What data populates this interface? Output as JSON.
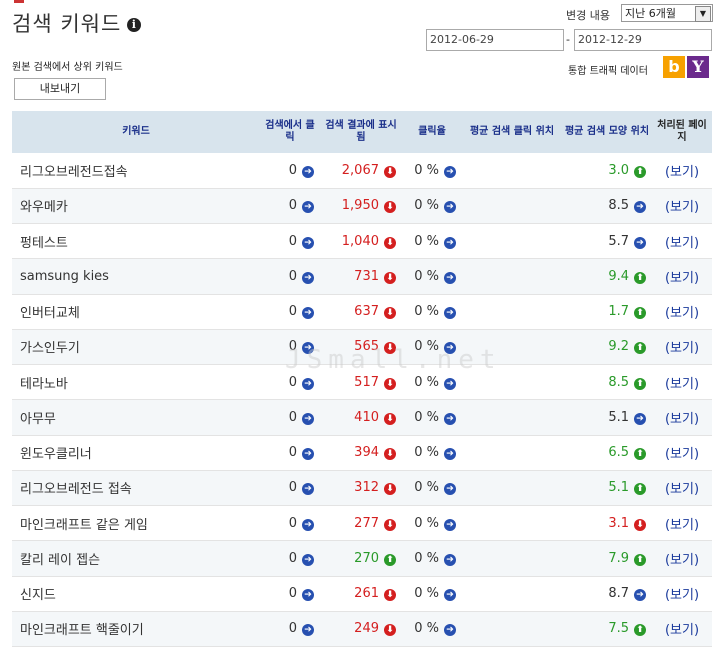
{
  "header": {
    "title": "검색 키워드",
    "info_icon": "info-icon",
    "range_label": "변경 내용",
    "range_value": "지난 6개월",
    "date_from": "2012-06-29",
    "date_sep": "-",
    "date_to": "2012-12-29",
    "subtitle": "원본 검색에서 상위 키워드",
    "traffic_label": "통합 트래픽 데이터",
    "bing_glyph": "b",
    "yahoo_glyph": "Y",
    "export_label": "내보내기"
  },
  "watermark": "JSmall.net",
  "table": {
    "columns": [
      "키워드",
      "검색에서 클릭",
      "검색 결과에 표시됨",
      "클릭율",
      "평균 검색 클릭 위치",
      "평균 검색 모양 위치",
      "처리된 페이지"
    ],
    "rows": [
      {
        "keyword": "리그오브레전드접속",
        "clicks": "0",
        "clicks_trend": "right",
        "impressions": "2,067",
        "imp_trend": "down",
        "ctr": "0 %",
        "ctr_trend": "right",
        "avg_click": "",
        "avg_pos": "3.0",
        "pos_trend": "up",
        "view": "(보기)"
      },
      {
        "keyword": "와우메카",
        "clicks": "0",
        "clicks_trend": "right",
        "impressions": "1,950",
        "imp_trend": "down",
        "ctr": "0 %",
        "ctr_trend": "right",
        "avg_click": "",
        "avg_pos": "8.5",
        "pos_trend": "right",
        "view": "(보기)"
      },
      {
        "keyword": "펑테스트",
        "clicks": "0",
        "clicks_trend": "right",
        "impressions": "1,040",
        "imp_trend": "down",
        "ctr": "0 %",
        "ctr_trend": "right",
        "avg_click": "",
        "avg_pos": "5.7",
        "pos_trend": "right",
        "view": "(보기)"
      },
      {
        "keyword": "samsung kies",
        "clicks": "0",
        "clicks_trend": "right",
        "impressions": "731",
        "imp_trend": "down",
        "ctr": "0 %",
        "ctr_trend": "right",
        "avg_click": "",
        "avg_pos": "9.4",
        "pos_trend": "up",
        "view": "(보기)"
      },
      {
        "keyword": "인버터교체",
        "clicks": "0",
        "clicks_trend": "right",
        "impressions": "637",
        "imp_trend": "down",
        "ctr": "0 %",
        "ctr_trend": "right",
        "avg_click": "",
        "avg_pos": "1.7",
        "pos_trend": "up",
        "view": "(보기)"
      },
      {
        "keyword": "가스인두기",
        "clicks": "0",
        "clicks_trend": "right",
        "impressions": "565",
        "imp_trend": "down",
        "ctr": "0 %",
        "ctr_trend": "right",
        "avg_click": "",
        "avg_pos": "9.2",
        "pos_trend": "up",
        "view": "(보기)"
      },
      {
        "keyword": "테라노바",
        "clicks": "0",
        "clicks_trend": "right",
        "impressions": "517",
        "imp_trend": "down",
        "ctr": "0 %",
        "ctr_trend": "right",
        "avg_click": "",
        "avg_pos": "8.5",
        "pos_trend": "up",
        "view": "(보기)"
      },
      {
        "keyword": "아무무",
        "clicks": "0",
        "clicks_trend": "right",
        "impressions": "410",
        "imp_trend": "down",
        "ctr": "0 %",
        "ctr_trend": "right",
        "avg_click": "",
        "avg_pos": "5.1",
        "pos_trend": "right",
        "view": "(보기)"
      },
      {
        "keyword": "윈도우클리너",
        "clicks": "0",
        "clicks_trend": "right",
        "impressions": "394",
        "imp_trend": "down",
        "ctr": "0 %",
        "ctr_trend": "right",
        "avg_click": "",
        "avg_pos": "6.5",
        "pos_trend": "up",
        "view": "(보기)"
      },
      {
        "keyword": "리그오브레전드 접속",
        "clicks": "0",
        "clicks_trend": "right",
        "impressions": "312",
        "imp_trend": "down",
        "ctr": "0 %",
        "ctr_trend": "right",
        "avg_click": "",
        "avg_pos": "5.1",
        "pos_trend": "up",
        "view": "(보기)"
      },
      {
        "keyword": "마인크래프트 같은 게임",
        "clicks": "0",
        "clicks_trend": "right",
        "impressions": "277",
        "imp_trend": "down",
        "ctr": "0 %",
        "ctr_trend": "right",
        "avg_click": "",
        "avg_pos": "3.1",
        "pos_trend": "down",
        "view": "(보기)"
      },
      {
        "keyword": "칼리 레이 젭슨",
        "clicks": "0",
        "clicks_trend": "right",
        "impressions": "270",
        "imp_trend": "up",
        "ctr": "0 %",
        "ctr_trend": "right",
        "avg_click": "",
        "avg_pos": "7.9",
        "pos_trend": "up",
        "view": "(보기)"
      },
      {
        "keyword": "신지드",
        "clicks": "0",
        "clicks_trend": "right",
        "impressions": "261",
        "imp_trend": "down",
        "ctr": "0 %",
        "ctr_trend": "right",
        "avg_click": "",
        "avg_pos": "8.7",
        "pos_trend": "right",
        "view": "(보기)"
      },
      {
        "keyword": "마인크래프트 핵줄이기",
        "clicks": "0",
        "clicks_trend": "right",
        "impressions": "249",
        "imp_trend": "down",
        "ctr": "0 %",
        "ctr_trend": "right",
        "avg_click": "",
        "avg_pos": "7.5",
        "pos_trend": "up",
        "view": "(보기)"
      }
    ]
  },
  "colors": {
    "header_bg": "#d8e4ed",
    "header_text": "#1a2f8a",
    "down": "#d41f1f",
    "up": "#2a9a2a",
    "neutral": "#2750b0",
    "link": "#1a3a9c"
  }
}
